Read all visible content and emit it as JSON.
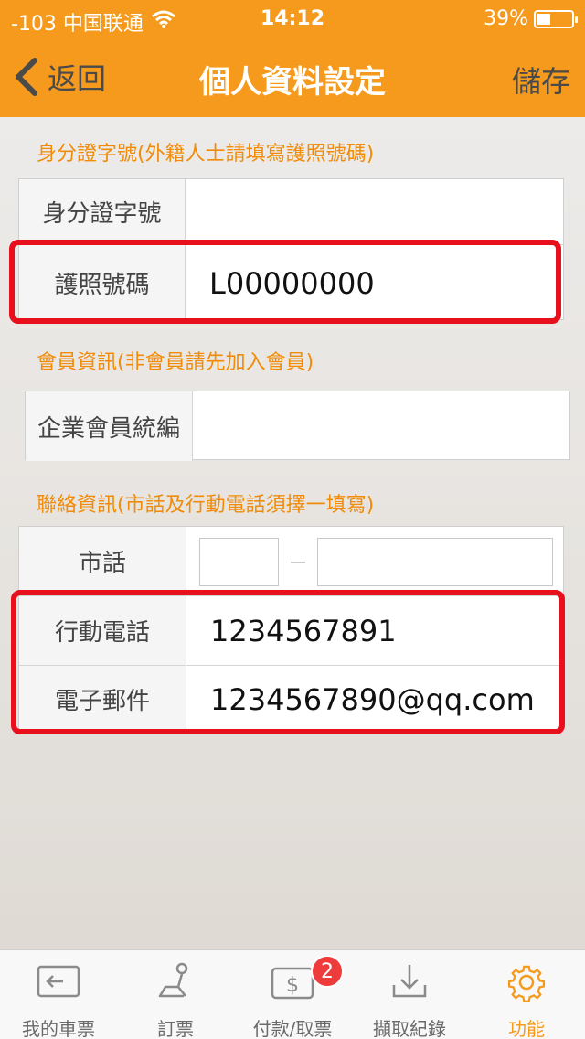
{
  "status_bar": {
    "carrier": "-103 中国联通",
    "time": "14:12",
    "battery": "39%",
    "battery_level": 0.39
  },
  "nav": {
    "back_label": "返回",
    "title": "個人資料設定",
    "save_label": "儲存"
  },
  "identity_section": {
    "label": "身分證字號(外籍人士請填寫護照號碼)",
    "rows": [
      {
        "label": "身分證字號",
        "value": ""
      },
      {
        "label": "護照號碼",
        "value": "L00000000"
      }
    ]
  },
  "member_section": {
    "label": "會員資訊(非會員請先加入會員)",
    "rows": [
      {
        "label": "企業會員統編",
        "value": ""
      }
    ]
  },
  "contact_section": {
    "label": "聯絡資訊(市話及行動電話須擇一填寫)",
    "landline": {
      "label": "市話",
      "area_code": "",
      "number": ""
    },
    "rows": [
      {
        "label": "行動電話",
        "value": "1234567891"
      },
      {
        "label": "電子郵件",
        "value": "1234567890@qq.com"
      }
    ]
  },
  "tabs": [
    {
      "label": "我的車票",
      "icon": "ticket-icon"
    },
    {
      "label": "訂票",
      "icon": "seat-icon"
    },
    {
      "label": "付款/取票",
      "icon": "payment-icon",
      "badge": "2"
    },
    {
      "label": "擷取紀錄",
      "icon": "download-icon"
    },
    {
      "label": "功能",
      "icon": "gear-icon",
      "active": true
    }
  ],
  "colors": {
    "brand": "#f59a1c",
    "section_label": "#f08c0a",
    "highlight": "#e8101d",
    "badge": "#ee3b3b"
  }
}
